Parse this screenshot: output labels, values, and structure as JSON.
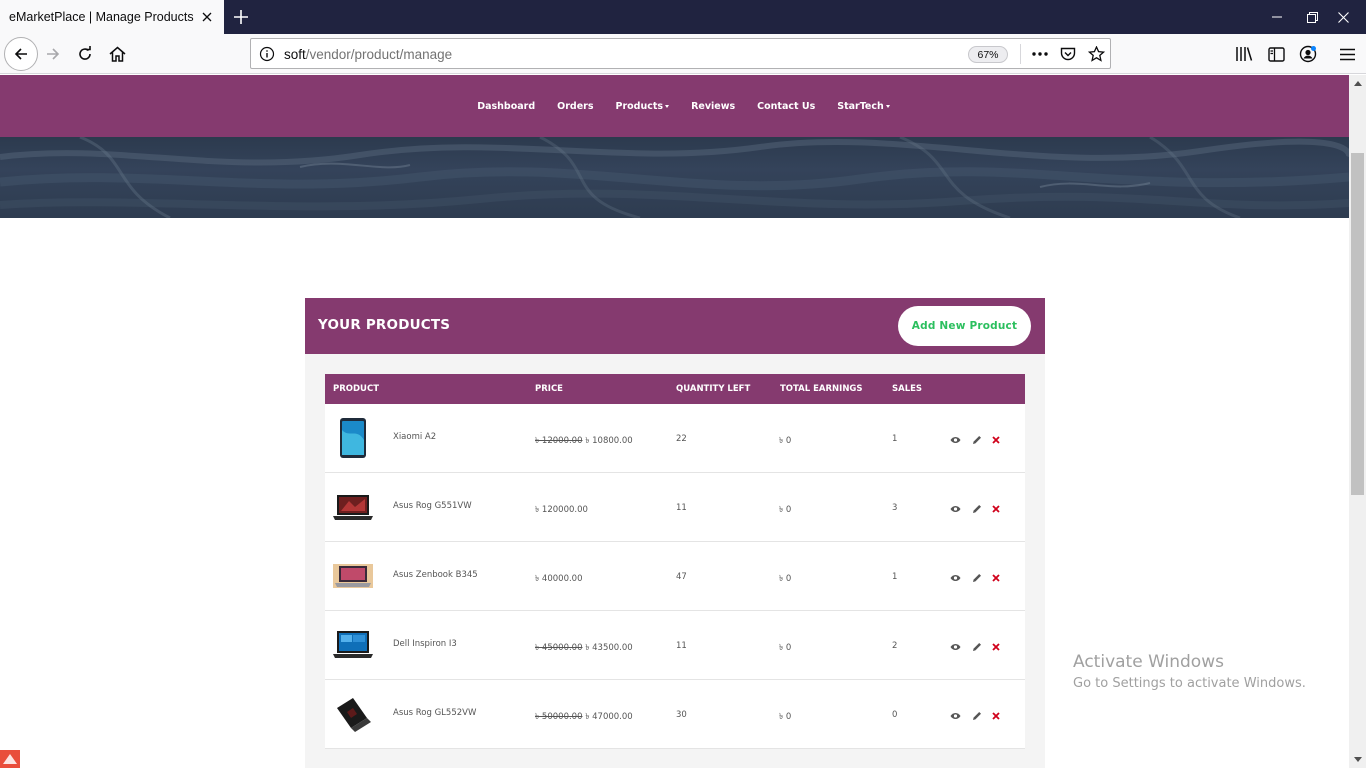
{
  "browser": {
    "tab_title": "eMarketPlace | Manage Products",
    "url_host": "soft",
    "url_path": "/vendor/product/manage",
    "zoom": "67%"
  },
  "site_menu": {
    "dashboard": "Dashboard",
    "orders": "Orders",
    "products": "Products",
    "reviews": "Reviews",
    "contact": "Contact Us",
    "store": "StarTech"
  },
  "panel": {
    "title": "YOUR PRODUCTS",
    "add_button": "Add New Product"
  },
  "table": {
    "headers": {
      "product": "PRODUCT",
      "price": "PRICE",
      "quantity": "QUANTITY LEFT",
      "earnings": "TOTAL EARNINGS",
      "sales": "SALES"
    },
    "rows": [
      {
        "name": "Xiaomi A2",
        "old_price": "৳ 12000.00",
        "price": "৳ 10800.00",
        "quantity": "22",
        "earnings": "৳ 0",
        "sales": "1"
      },
      {
        "name": "Asus Rog G551VW",
        "old_price": "",
        "price": "৳ 120000.00",
        "quantity": "11",
        "earnings": "৳ 0",
        "sales": "3"
      },
      {
        "name": "Asus Zenbook B345",
        "old_price": "",
        "price": "৳ 40000.00",
        "quantity": "47",
        "earnings": "৳ 0",
        "sales": "1"
      },
      {
        "name": "Dell Inspiron I3",
        "old_price": "৳ 45000.00",
        "price": "৳ 43500.00",
        "quantity": "11",
        "earnings": "৳ 0",
        "sales": "2"
      },
      {
        "name": "Asus Rog GL552VW",
        "old_price": "৳ 50000.00",
        "price": "৳ 47000.00",
        "quantity": "30",
        "earnings": "৳ 0",
        "sales": "0"
      }
    ]
  },
  "watermark": {
    "title": "Activate Windows",
    "subtitle": "Go to Settings to activate Windows."
  },
  "colors": {
    "brand": "#853a6f",
    "add_button_text": "#2bbf5e",
    "delete": "#d0021b"
  }
}
